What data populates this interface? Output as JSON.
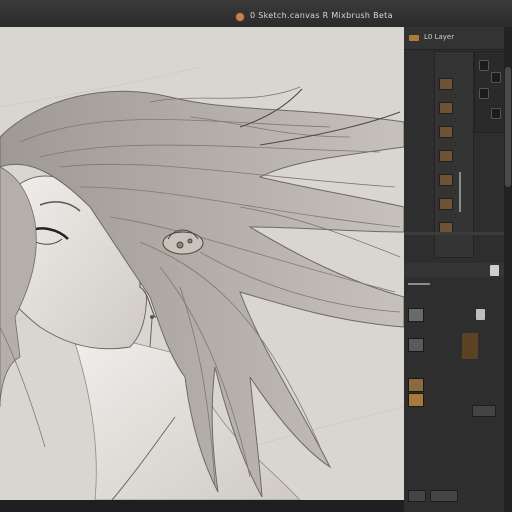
{
  "window": {
    "title": "0  Sketch.canvas  R  Mixbrush Beta",
    "icon": "app-icon"
  },
  "panel": {
    "title": "L0 Layer",
    "icon": "layers-icon"
  },
  "colors": {
    "accent": "#c9804a",
    "canvas": "#d9d6d2",
    "panel": "#2e2e2e"
  }
}
